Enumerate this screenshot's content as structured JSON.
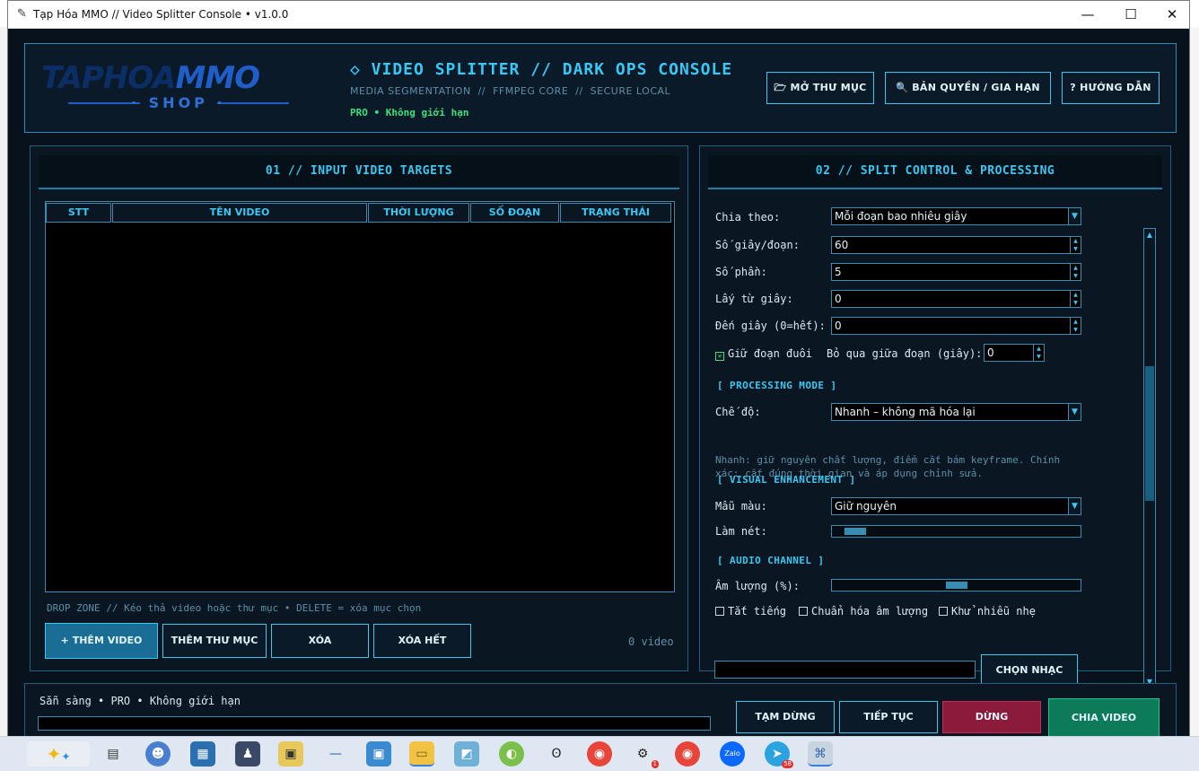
{
  "window": {
    "title": "Tạp Hóa MMO // Video Splitter Console • v1.0.0",
    "controls": {
      "minimize": "—",
      "maximize": "☐",
      "close": "✕"
    }
  },
  "header": {
    "logo": {
      "word1": "TAPHOA",
      "word2": "MMO",
      "shop": "SHOP"
    },
    "title": "◇ VIDEO SPLITTER // DARK OPS CONSOLE",
    "subtitle": "MEDIA SEGMENTATION  //  FFMPEG CORE  //  SECURE LOCAL",
    "license": "PRO • Không giới hạn",
    "buttons": {
      "open_folder": "🗁 MỞ THƯ MỤC",
      "license": "🔍 BẢN QUYỀN / GIA HẠN",
      "guide": "? HƯỚNG DẪN"
    }
  },
  "left_panel": {
    "title": "01 // INPUT VIDEO TARGETS",
    "columns": [
      "STT",
      "TÊN VIDEO",
      "THỜI LƯỢNG",
      "SỐ ĐOẠN",
      "TRẠNG THÁI"
    ],
    "rows": [],
    "drop_zone": "DROP ZONE // Kéo thả video hoặc thư mục • DELETE = xóa mục chọn",
    "buttons": {
      "add_video": "+ THÊM VIDEO",
      "add_folder": "THÊM THƯ MỤC",
      "delete": "XÓA",
      "delete_all": "XÓA HẾT"
    },
    "count": "0 video"
  },
  "right_panel": {
    "title": "02 // SPLIT CONTROL & PROCESSING",
    "split_by": {
      "label": "Chia theo:",
      "value": "Mỗi đoạn bao nhiêu giây"
    },
    "seconds_per_segment": {
      "label": "Số giây/đoạn:",
      "value": "60"
    },
    "parts": {
      "label": "Số phần:",
      "value": "5"
    },
    "from_second": {
      "label": "Lấy từ giây:",
      "value": "0"
    },
    "to_second": {
      "label": "Đến giây (0=hết):",
      "value": "0"
    },
    "keep_tail": {
      "label": "Giữ đoạn đuôi",
      "checked": true
    },
    "skip_between": {
      "label": "Bỏ qua giữa đoạn (giây):",
      "value": "0"
    },
    "processing_section": "[ PROCESSING MODE ]",
    "mode": {
      "label": "Chế độ:",
      "value": "Nhanh – không mã hóa lại"
    },
    "mode_note": "Nhanh: giữ nguyên chất lượng, điểm cắt bám keyframe. Chính xác: cắt đúng thời gian và áp dụng chỉnh sửa.",
    "visual_section": "[ VISUAL ENHANCEMENT ]",
    "color_preset": {
      "label": "Mẫu màu:",
      "value": "Giữ nguyên"
    },
    "sharpen": {
      "label": "Làm nét:",
      "level": 0.05
    },
    "audio_section": "[ AUDIO CHANNEL ]",
    "volume": {
      "label": "Âm lượng (%):",
      "level": 0.5
    },
    "mute": {
      "label": "Tắt tiếng",
      "checked": false
    },
    "normalize": {
      "label": "Chuẩn hóa âm lượng",
      "checked": false
    },
    "denoise": {
      "label": "Khử nhiễu nhẹ",
      "checked": false
    },
    "music_path": "",
    "music_button": "CHỌN NHẠC"
  },
  "status": {
    "text": "Sẵn sàng • PRO • Không giới hạn",
    "progress": 0,
    "buttons": {
      "pause": "TẠM DỪNG",
      "resume": "TIẾP TỤC",
      "stop": "DỪNG",
      "split": "CHIA VIDEO"
    }
  },
  "taskbar": {
    "items": [
      {
        "name": "copilot-icon"
      },
      {
        "name": "task-view-icon"
      },
      {
        "name": "teams-icon"
      },
      {
        "name": "media-player-icon"
      },
      {
        "name": "spy-app-icon"
      },
      {
        "name": "save-app-icon"
      },
      {
        "name": "dash-app-icon"
      },
      {
        "name": "floppy-app-icon"
      },
      {
        "name": "file-explorer-icon"
      },
      {
        "name": "notes-app-icon"
      },
      {
        "name": "green-app-icon"
      },
      {
        "name": "panda-app-icon"
      },
      {
        "name": "chrome-icon"
      },
      {
        "name": "openai-icon"
      },
      {
        "name": "chrome-profile-icon"
      },
      {
        "name": "zalo-icon"
      },
      {
        "name": "telegram-icon"
      },
      {
        "name": "python-icon"
      }
    ],
    "openai_badge": "1",
    "zalo_label": "Zalo",
    "telegram_badge": "58"
  },
  "colors": {
    "accent": "#3cc6f0",
    "license": "#3ee07a",
    "stop": "#8c1a3a",
    "split": "#0d7a5a",
    "background": "#08121c"
  }
}
